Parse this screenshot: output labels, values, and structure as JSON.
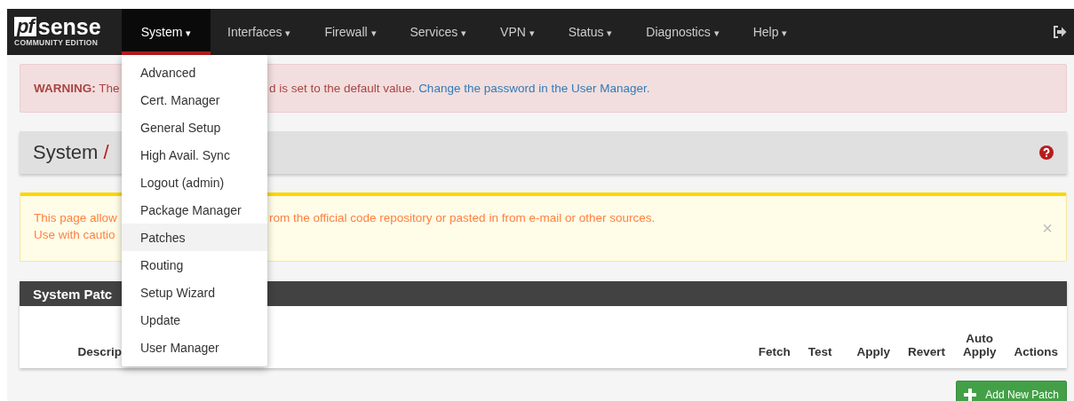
{
  "navbar": {
    "logo": {
      "mark": "pf",
      "wordmark": "sense",
      "edition": "COMMUNITY EDITION"
    },
    "menu": [
      {
        "label": "System",
        "caret": "▾",
        "selected": true
      },
      {
        "label": "Interfaces",
        "caret": "▾",
        "selected": false
      },
      {
        "label": "Firewall",
        "caret": "▾",
        "selected": false
      },
      {
        "label": "Services",
        "caret": "▾",
        "selected": false
      },
      {
        "label": "VPN",
        "caret": "▾",
        "selected": false
      },
      {
        "label": "Status",
        "caret": "▾",
        "selected": false
      },
      {
        "label": "Diagnostics",
        "caret": "▾",
        "selected": false
      },
      {
        "label": "Help",
        "caret": "▾",
        "selected": false
      }
    ]
  },
  "dropdown": {
    "items": [
      {
        "label": "Advanced",
        "selected": false
      },
      {
        "label": "Cert. Manager",
        "selected": false
      },
      {
        "label": "General Setup",
        "selected": false
      },
      {
        "label": "High Avail. Sync",
        "selected": false
      },
      {
        "label": "Logout (admin)",
        "selected": false
      },
      {
        "label": "Package Manager",
        "selected": false
      },
      {
        "label": "Patches",
        "selected": true
      },
      {
        "label": "Routing",
        "selected": false
      },
      {
        "label": "Setup Wizard",
        "selected": false
      },
      {
        "label": "Update",
        "selected": false
      },
      {
        "label": "User Manager",
        "selected": false
      }
    ]
  },
  "warning_alert": {
    "left": "**WARNING:** The",
    "right": "d is set to the default value.",
    "link": "Change the password in the User Manager."
  },
  "breadcrumb": {
    "section": "System",
    "separator": "/"
  },
  "info_alert": {
    "lines": [
      {
        "left": "This page allow",
        "right": "rom the official code repository or pasted in from e-mail or other sources."
      },
      {
        "left": "Use with cautio"
      }
    ],
    "close": "×"
  },
  "panel": {
    "title": "System Patc",
    "columns": [
      "Descrip",
      "Fetch",
      "Test",
      "Apply",
      "Revert",
      "Auto Apply",
      "Actions"
    ]
  },
  "add_button": {
    "label": "Add New Patch"
  }
}
